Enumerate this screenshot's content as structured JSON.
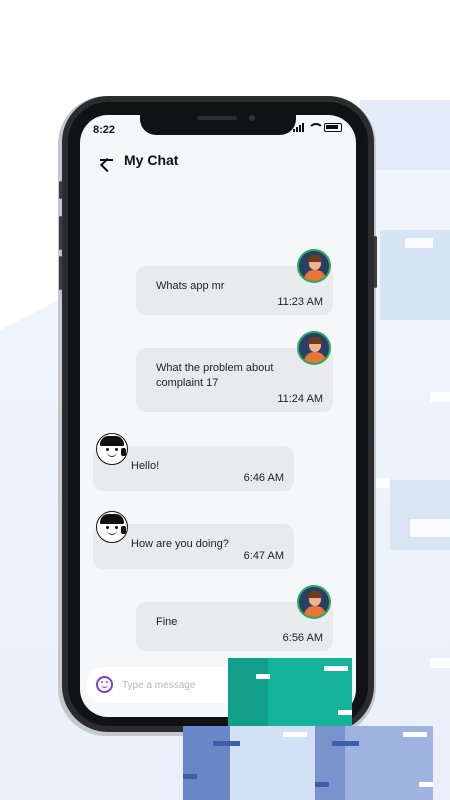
{
  "status_bar": {
    "time": "8:22"
  },
  "header": {
    "title": "My Chat"
  },
  "messages": [
    {
      "direction": "outgoing",
      "text": "Whats app mr",
      "time": "11:23 AM"
    },
    {
      "direction": "outgoing",
      "text": "What the problem about complaint 17",
      "time": "11:24 AM"
    },
    {
      "direction": "incoming",
      "text": "Hello!",
      "time": "6:46 AM"
    },
    {
      "direction": "incoming",
      "text": "How are you doing?",
      "time": "6:47 AM"
    },
    {
      "direction": "outgoing",
      "text": "Fine",
      "time": "6:56 AM"
    }
  ],
  "composer": {
    "placeholder": "Type a message",
    "value": ""
  },
  "colors": {
    "accent": "#7c3fd2",
    "bubble": "#e9eaec",
    "teal_box": "#16b39b",
    "blue_box": "#6b86c4"
  }
}
